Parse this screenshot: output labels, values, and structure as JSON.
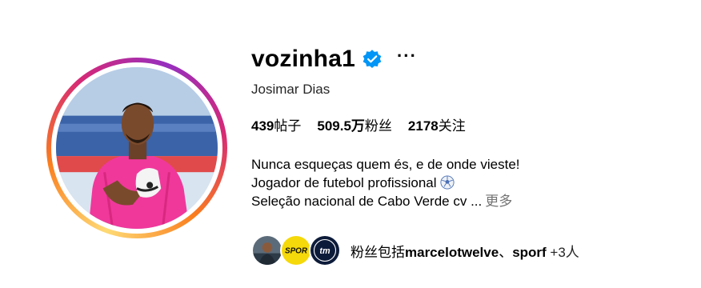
{
  "profile": {
    "username": "vozinha1",
    "full_name": "Josimar Dias",
    "verified": true
  },
  "stats": {
    "posts_value": "439",
    "posts_label": "帖子",
    "followers_value": "509.5万",
    "followers_label": "粉丝",
    "following_value": "2178",
    "following_label": "关注"
  },
  "bio": {
    "line1": "Nunca esqueças quem és, e de onde vieste!",
    "line2": "Jogador de futebol profissional",
    "line3": "Seleção nacional de Cabo Verde cv ...",
    "more_label": "更多"
  },
  "followed_by": {
    "prefix": "粉丝包括",
    "user1": "marcelotwelve",
    "separator": "、",
    "user2": "sporf",
    "extra": " +3人",
    "avatar2_text": "SPOR",
    "avatar3_text": "tm"
  },
  "icons": {
    "verified": "verified-badge-icon",
    "more": "more-options-icon",
    "soccer": "soccer-ball-icon"
  },
  "colors": {
    "verified_blue": "#0095f6",
    "muted_gray": "#737373"
  }
}
